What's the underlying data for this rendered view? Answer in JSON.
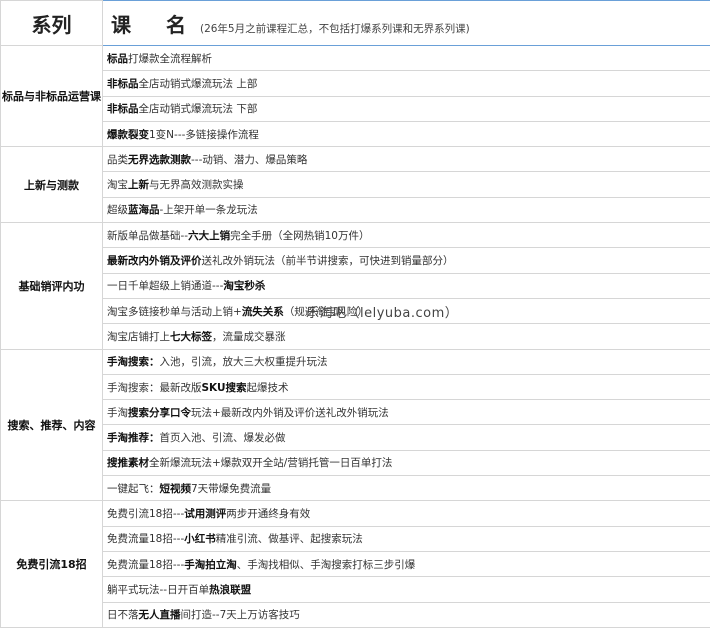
{
  "header": {
    "series_label": "系列",
    "name_label": "课 名",
    "name_note": "(26年5月之前课程汇总，不包括打爆系列课和无界系列课)"
  },
  "sections": [
    {
      "title": "标品与非标品运营课",
      "items": [
        [
          {
            "t": "标品",
            "b": true
          },
          {
            "t": "打爆款全流程解析",
            "b": false
          }
        ],
        [
          {
            "t": "非标品",
            "b": true
          },
          {
            "t": "全店动销式爆流玩法   上部",
            "b": false
          }
        ],
        [
          {
            "t": "非标品",
            "b": true
          },
          {
            "t": "全店动销式爆流玩法   下部",
            "b": false
          }
        ],
        [
          {
            "t": "爆款裂变",
            "b": true
          },
          {
            "t": "1变N---多链接操作流程",
            "b": false
          }
        ]
      ]
    },
    {
      "title": "上新与测款",
      "items": [
        [
          {
            "t": "品类",
            "b": false
          },
          {
            "t": "无界选款测款",
            "b": true
          },
          {
            "t": "---动销、潜力、爆品策略",
            "b": false
          }
        ],
        [
          {
            "t": "淘宝",
            "b": false
          },
          {
            "t": "上新",
            "b": true
          },
          {
            "t": "与无界高效测款实操",
            "b": false
          }
        ],
        [
          {
            "t": "超级",
            "b": false
          },
          {
            "t": "蓝海品",
            "b": true
          },
          {
            "t": "-上架开单一条龙玩法",
            "b": false
          }
        ]
      ]
    },
    {
      "title": "基础销评内功",
      "items": [
        [
          {
            "t": "新版单品做基础--",
            "b": false
          },
          {
            "t": "六大上销",
            "b": true
          },
          {
            "t": "完全手册（全网热销10万件）",
            "b": false
          }
        ],
        [
          {
            "t": "最新改内外销及评价",
            "b": true
          },
          {
            "t": "送礼改外销玩法（前半节讲搜索，可快进到销量部分）",
            "b": false
          }
        ],
        [
          {
            "t": "一日千单超级上销通道---",
            "b": false
          },
          {
            "t": "淘宝秒杀",
            "b": true
          }
        ],
        [
          {
            "t": "淘宝多链接秒单与活动上销+",
            "b": false
          },
          {
            "t": "流失关系",
            "b": true
          },
          {
            "t": "（规避淘宝风险）",
            "b": false
          }
        ],
        [
          {
            "t": "淘宝店铺打上",
            "b": false
          },
          {
            "t": "七大标签",
            "b": true
          },
          {
            "t": "，流量成交暴涨",
            "b": false
          }
        ]
      ]
    },
    {
      "title": "搜索、推荐、内容",
      "items": [
        [
          {
            "t": "手淘搜索：",
            "b": true
          },
          {
            "t": "入池，引流，放大三大权重提升玩法",
            "b": false
          }
        ],
        [
          {
            "t": "手淘搜索：最新改版",
            "b": false
          },
          {
            "t": "SKU搜索",
            "b": true
          },
          {
            "t": "起爆技术",
            "b": false
          }
        ],
        [
          {
            "t": "手淘",
            "b": false
          },
          {
            "t": "搜索分享口令",
            "b": true
          },
          {
            "t": "玩法+最新改内外销及评价送礼改外销玩法",
            "b": false
          }
        ],
        [
          {
            "t": "手淘推荐：",
            "b": true
          },
          {
            "t": "首页入池、引流、爆发必做",
            "b": false
          }
        ],
        [
          {
            "t": "搜推素材",
            "b": true
          },
          {
            "t": "全新爆流玩法+爆款双开全站/营销托管一日百单打法",
            "b": false
          }
        ],
        [
          {
            "t": "一键起飞：",
            "b": false
          },
          {
            "t": "短视频",
            "b": true
          },
          {
            "t": "7天带爆免费流量",
            "b": false
          }
        ]
      ]
    },
    {
      "title": "免费引流18招",
      "items": [
        [
          {
            "t": "免费引流18招---",
            "b": false
          },
          {
            "t": "试用测评",
            "b": true
          },
          {
            "t": "两步开通终身有效",
            "b": false
          }
        ],
        [
          {
            "t": "免费流量18招---",
            "b": false
          },
          {
            "t": "小红书",
            "b": true
          },
          {
            "t": "精准引流、做基评、起搜索玩法",
            "b": false
          }
        ],
        [
          {
            "t": "免费流量18招---",
            "b": false
          },
          {
            "t": "手淘拍立淘",
            "b": true
          },
          {
            "t": "、手淘找相似、手淘搜索打标三步引爆",
            "b": false
          }
        ],
        [
          {
            "t": "躺平式玩法--日开百单",
            "b": false
          },
          {
            "t": "热浪联盟",
            "b": true
          }
        ],
        [
          {
            "t": "日不落",
            "b": false
          },
          {
            "t": "无人直播",
            "b": true
          },
          {
            "t": "间打造--7天上万访客技巧",
            "b": false
          }
        ]
      ]
    }
  ],
  "watermark": "乐淘吧（lelyuba.com）"
}
